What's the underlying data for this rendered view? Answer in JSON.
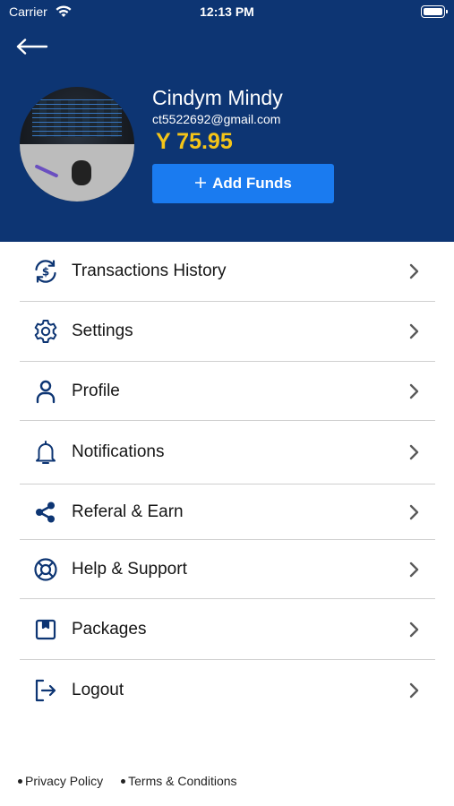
{
  "status_bar": {
    "carrier": "Carrier",
    "time": "12:13 PM"
  },
  "colors": {
    "header_bg": "#0d3573",
    "accent": "#1a7bf0",
    "balance": "#f5c518",
    "icon": "#0d3573"
  },
  "profile": {
    "name": "Cindym Mindy",
    "email": "ct5522692@gmail.com",
    "balance": "Y 75.95",
    "add_funds_label": "Add Funds"
  },
  "menu": {
    "items": [
      {
        "label": "Transactions History",
        "icon": "currency-exchange-icon"
      },
      {
        "label": "Settings",
        "icon": "gear-icon"
      },
      {
        "label": "Profile",
        "icon": "person-icon"
      },
      {
        "label": "Notifications",
        "icon": "bell-icon"
      },
      {
        "label": "Referal & Earn",
        "icon": "share-icon"
      },
      {
        "label": "Help & Support",
        "icon": "lifebuoy-icon"
      },
      {
        "label": "Packages",
        "icon": "package-icon"
      },
      {
        "label": "Logout",
        "icon": "logout-icon"
      }
    ]
  },
  "footer": {
    "privacy": "Privacy Policy",
    "terms": "Terms & Conditions"
  }
}
